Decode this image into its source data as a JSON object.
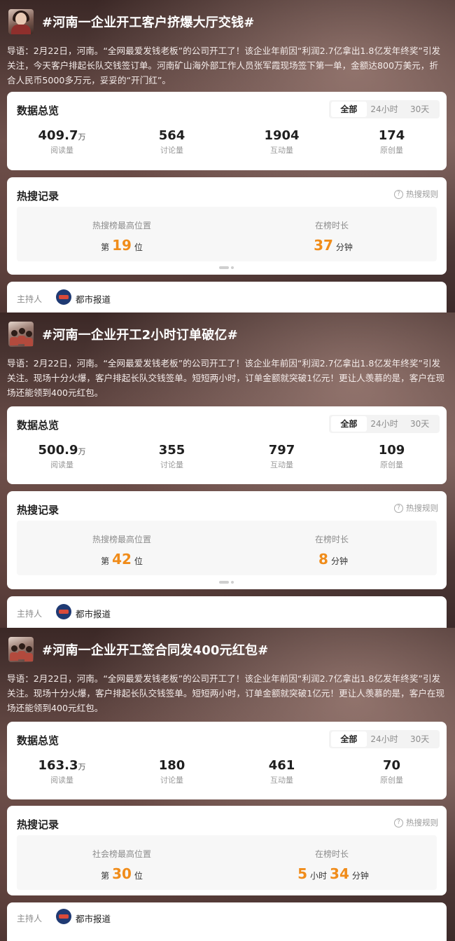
{
  "topics": [
    {
      "title": "#河南一企业开工客户挤爆大厅交钱#",
      "intro": "导语：2月22日，河南。“全网最爱发钱老板”的公司开工了！该企业年前因“利润2.7亿拿出1.8亿发年终奖”引发关注，今天客户排起长队交钱签订单。河南矿山海外部工作人员张军霞现场签下第一单，金额达800万美元，折合人民币5000多万元，妥妥的“开门红”。",
      "overview": {
        "title": "数据总览",
        "tabs": [
          "全部",
          "24小时",
          "30天"
        ],
        "stats": [
          {
            "value": "409.7",
            "unit": "万",
            "label": "阅读量"
          },
          {
            "value": "564",
            "unit": "",
            "label": "讨论量"
          },
          {
            "value": "1904",
            "unit": "",
            "label": "互动量"
          },
          {
            "value": "174",
            "unit": "",
            "label": "原创量"
          }
        ]
      },
      "hot": {
        "title": "热搜记录",
        "rule": "热搜规则",
        "left_caption": "热搜榜最高位置",
        "left_prefix": "第",
        "left_value": "19",
        "left_suffix": "位",
        "right_caption": "在榜时长",
        "right_value": "37",
        "right_suffix": "分钟"
      },
      "host": {
        "label": "主持人",
        "name": "都市报道"
      }
    },
    {
      "title": "#河南一企业开工2小时订单破亿#",
      "intro": "导语：2月22日，河南。“全网最爱发钱老板”的公司开工了！该企业年前因“利润2.7亿拿出1.8亿发年终奖”引发关注。现场十分火爆，客户排起长队交钱签单。短短两小时，订单金额就突破1亿元！更让人羡慕的是，客户在现场还能领到400元红包。",
      "overview": {
        "title": "数据总览",
        "tabs": [
          "全部",
          "24小时",
          "30天"
        ],
        "stats": [
          {
            "value": "500.9",
            "unit": "万",
            "label": "阅读量"
          },
          {
            "value": "355",
            "unit": "",
            "label": "讨论量"
          },
          {
            "value": "797",
            "unit": "",
            "label": "互动量"
          },
          {
            "value": "109",
            "unit": "",
            "label": "原创量"
          }
        ]
      },
      "hot": {
        "title": "热搜记录",
        "rule": "热搜规则",
        "left_caption": "热搜榜最高位置",
        "left_prefix": "第",
        "left_value": "42",
        "left_suffix": "位",
        "right_caption": "在榜时长",
        "right_value": "8",
        "right_suffix": "分钟"
      },
      "host": {
        "label": "主持人",
        "name": "都市报道"
      }
    },
    {
      "title": "#河南一企业开工签合同发400元红包#",
      "intro": "导语：2月22日，河南。“全网最爱发钱老板”的公司开工了！该企业年前因“利润2.7亿拿出1.8亿发年终奖”引发关注。现场十分火爆，客户排起长队交钱签单。短短两小时，订单金额就突破1亿元！更让人羡慕的是，客户在现场还能领到400元红包。",
      "overview": {
        "title": "数据总览",
        "tabs": [
          "全部",
          "24小时",
          "30天"
        ],
        "stats": [
          {
            "value": "163.3",
            "unit": "万",
            "label": "阅读量"
          },
          {
            "value": "180",
            "unit": "",
            "label": "讨论量"
          },
          {
            "value": "461",
            "unit": "",
            "label": "互动量"
          },
          {
            "value": "70",
            "unit": "",
            "label": "原创量"
          }
        ]
      },
      "hot": {
        "title": "热搜记录",
        "rule": "热搜规则",
        "left_caption": "社会榜最高位置",
        "left_prefix": "第",
        "left_value": "30",
        "left_suffix": "位",
        "right_caption": "在榜时长",
        "right_value": "5",
        "right_mid": "小时",
        "right_value2": "34",
        "right_suffix": "分钟"
      },
      "host": {
        "label": "主持人",
        "name": "都市报道"
      }
    }
  ]
}
